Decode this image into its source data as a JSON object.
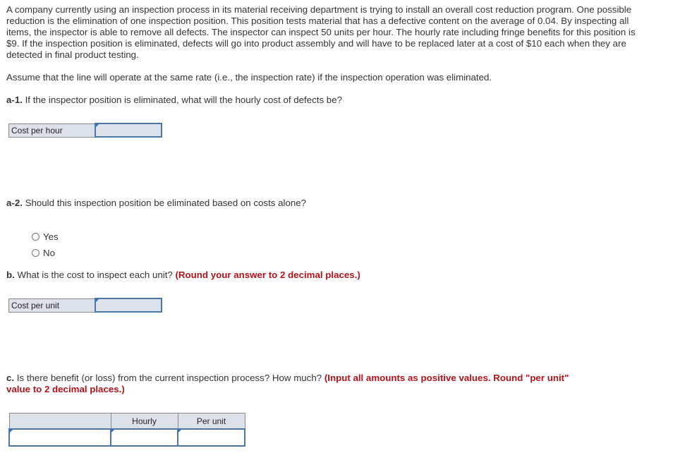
{
  "problem": {
    "intro": "A company currently using an inspection process in its material receiving department is trying to install an overall cost reduction program. One possible reduction is the elimination of one inspection position. This position tests material that has a defective content on the average of 0.04. By inspecting all items, the inspector is able to remove all defects. The inspector can inspect 50 units per hour. The hourly rate including fringe benefits for this position is $9. If the inspection position is eliminated, defects will go into product assembly and will have to be replaced later at a cost of $10 each when they are detected in final product testing.",
    "assumption": "Assume that the line will operate at the same rate (i.e., the inspection rate) if the inspection operation was eliminated."
  },
  "questions": {
    "a1": {
      "label": "a-1.",
      "text": " If the inspector position is eliminated, what will the hourly cost of defects be?",
      "field_label": "Cost per hour",
      "value": ""
    },
    "a2": {
      "label": "a-2.",
      "text": " Should this inspection position be eliminated based on costs alone?",
      "options": [
        "Yes",
        "No"
      ]
    },
    "b": {
      "label": "b.",
      "text": " What is the cost to inspect each unit? ",
      "instruction": "(Round your answer to 2 decimal places.)",
      "field_label": "Cost per unit",
      "value": ""
    },
    "c": {
      "label": "c.",
      "text": " Is there benefit (or loss) from the current inspection process? How much? ",
      "instruction_line1": "(Input all amounts as positive values. Round \"per unit\"",
      "instruction_line2": "value to 2 decimal places.)",
      "columns": [
        "",
        "Hourly",
        "Per unit"
      ],
      "row": {
        "label_value": "",
        "hourly_value": "",
        "per_unit_value": ""
      }
    }
  },
  "colors": {
    "instruction_red": "#b0131a",
    "input_border_blue": "#4a76a8",
    "cell_grey": "#dde1ea"
  }
}
